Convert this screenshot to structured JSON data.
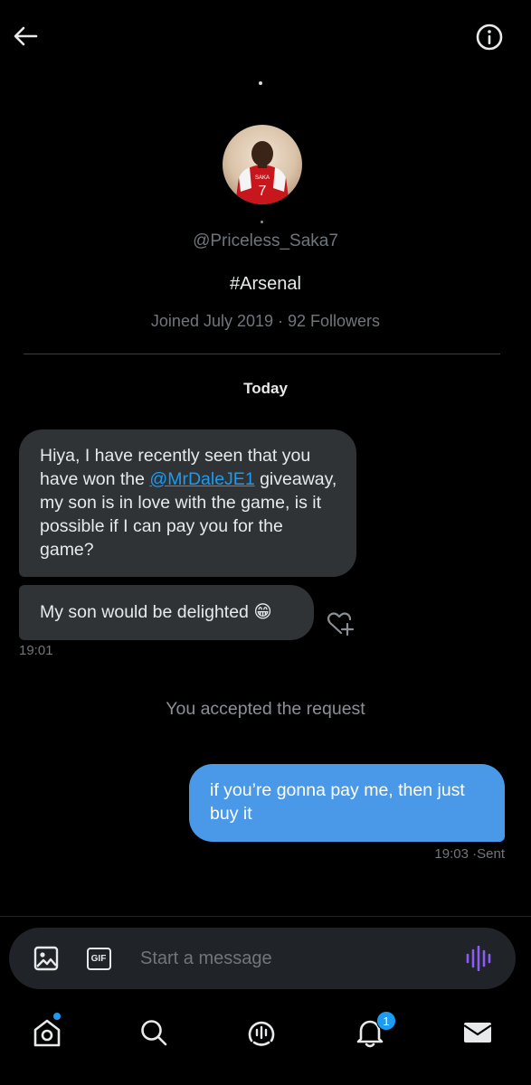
{
  "header": {
    "back_icon": "arrow-left-icon",
    "info_icon": "info-circle-icon"
  },
  "profile": {
    "avatar_icon": "profile-avatar",
    "handle": "@Priceless_Saka7",
    "bio": "#Arsenal",
    "meta": "Joined July 2019 · 92 Followers"
  },
  "conversation": {
    "date_label": "Today",
    "incoming": [
      {
        "text_before": "Hiya, I have recently seen that you have won the ",
        "mention": "@MrDaleJE1",
        "text_after": " giveaway, my son is in love with the game, is it possible if I can pay you for the game?"
      },
      {
        "text": "My son would be delighted 😁"
      }
    ],
    "incoming_time": "19:01",
    "system_message": "You accepted the request",
    "outgoing": {
      "text": "if you’re gonna pay me, then just buy it",
      "time": "19:03",
      "status": "·Sent"
    }
  },
  "composer": {
    "placeholder": "Start a message",
    "gif_label": "GIF",
    "accent": "#8b5cf6"
  },
  "nav": {
    "items": [
      "home-icon",
      "search-icon",
      "spaces-icon",
      "notifications-icon",
      "messages-icon"
    ],
    "notifications_count": "1",
    "accent": "#1d9bf0"
  }
}
